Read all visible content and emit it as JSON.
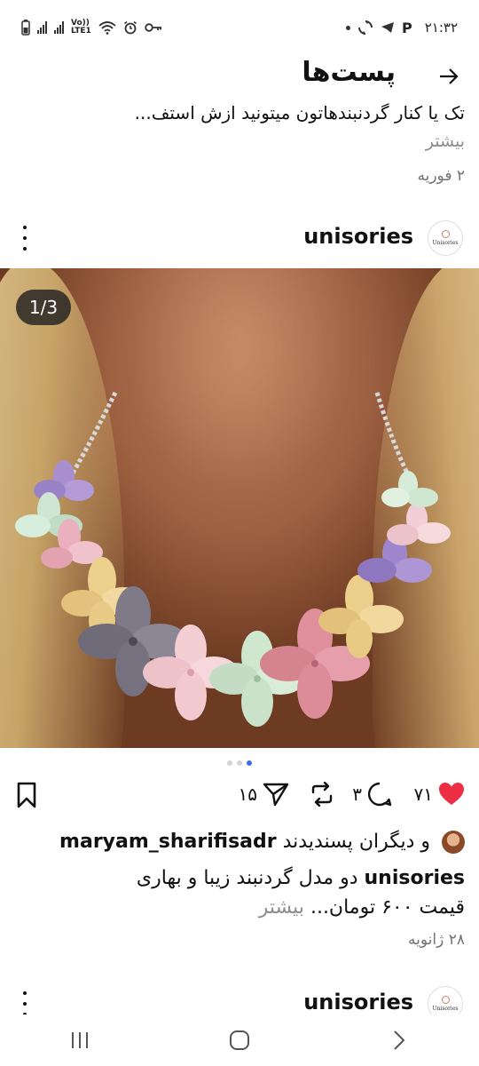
{
  "status_bar": {
    "time": "۲۱:۳۲",
    "network_label_top": "Vo))",
    "network_label_bottom": "LTE1",
    "telegram_p": "P"
  },
  "header": {
    "title": "پست‌ها",
    "back_icon": "arrow-right-icon"
  },
  "previous_post": {
    "caption": "تک یا کنار گردنبندهاتون میتونید ازش استف...",
    "more": "بیشتر",
    "date": "۲ فوریه"
  },
  "post": {
    "username": "unisories",
    "avatar_text": "Unisories",
    "image_counter": "1/3",
    "carousel": {
      "count": 3,
      "active": 3
    },
    "likes": "۷۱",
    "comments": "۳",
    "reposts": "",
    "shares": "۱۵",
    "liked_by_user": "maryam_sharifisadr",
    "liked_by_suffix": "و دیگران پسندیدند",
    "caption_user": "unisories",
    "caption_line1": "دو مدل گردنبند زیبا و بهاری",
    "caption_line2": "قیمت ۶۰۰ تومان...",
    "more": "بیشتر",
    "date": "۲۸ ژانویه",
    "colors": {
      "like": "#ed2f45",
      "accent_dot": "#3a6ee8"
    }
  },
  "next_post": {
    "username": "unisories",
    "avatar_text": "Unisories"
  },
  "nav_bar": {
    "recents": "|||",
    "home": "○",
    "back": "›"
  }
}
